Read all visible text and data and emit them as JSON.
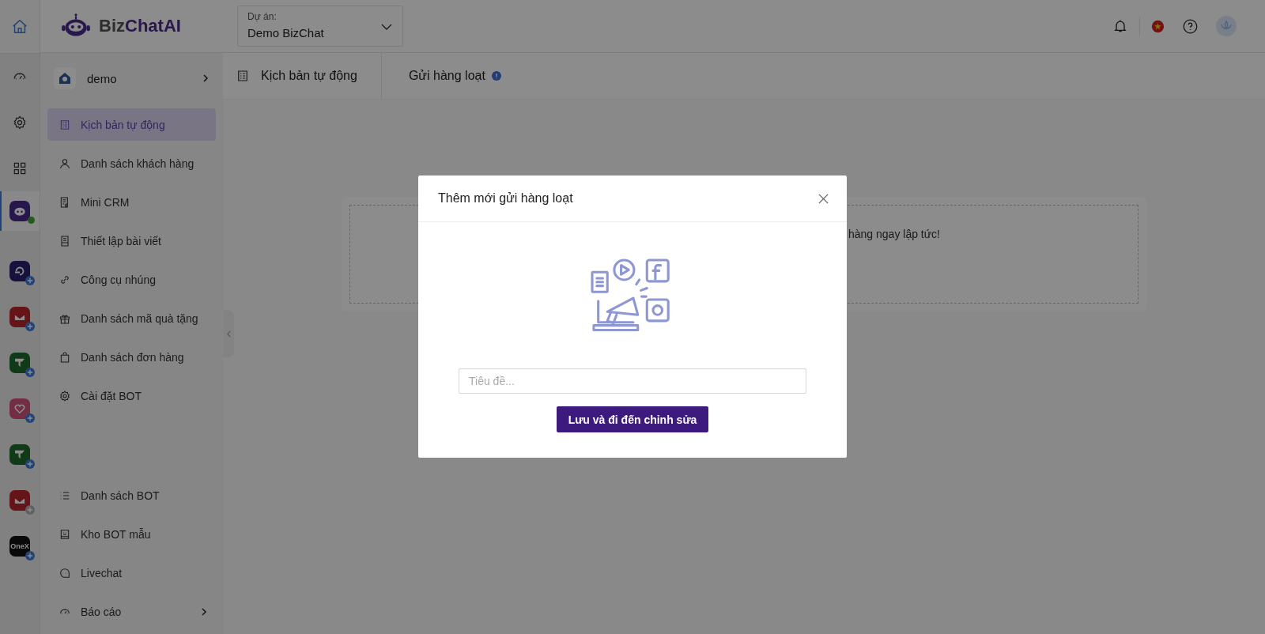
{
  "logo": {
    "part1": "Biz",
    "part2": "ChatAI"
  },
  "project": {
    "label": "Dự án:",
    "value": "Demo BizChat"
  },
  "rail": [
    {
      "kind": "gauge",
      "selected": false
    },
    {
      "kind": "gear",
      "selected": false
    },
    {
      "kind": "grid",
      "selected": false
    }
  ],
  "apps": [
    {
      "kind": "bot",
      "selected": true,
      "online": true
    },
    {
      "kind": "ring",
      "selected": false,
      "online": false,
      "plus_active": true
    },
    {
      "kind": "mail",
      "selected": false,
      "online": false,
      "plus_active": true
    },
    {
      "kind": "tee",
      "selected": false,
      "online": false,
      "plus_active": true
    },
    {
      "kind": "heart",
      "selected": false,
      "online": false,
      "plus_active": true
    },
    {
      "kind": "tee",
      "selected": false,
      "online": false,
      "plus_active": true
    },
    {
      "kind": "mail",
      "selected": false,
      "online": false,
      "plus_active": false
    },
    {
      "kind": "onex",
      "label": "OneX",
      "selected": false,
      "online": false,
      "plus_active": true
    }
  ],
  "bot": {
    "name": "demo"
  },
  "menu": [
    {
      "kind": "doc",
      "label": "Kịch bản tự động",
      "selected": true
    },
    {
      "kind": "user",
      "label": "Danh sách khách hàng",
      "selected": false
    },
    {
      "kind": "crm",
      "label": "Mini CRM",
      "selected": false
    },
    {
      "kind": "post",
      "label": "Thiết lập bài viết",
      "selected": false
    },
    {
      "kind": "link",
      "label": "Công cụ nhúng",
      "selected": false
    },
    {
      "kind": "gift",
      "label": "Danh sách mã quà tặng",
      "selected": false
    },
    {
      "kind": "bag",
      "label": "Danh sách đơn hàng",
      "selected": false
    },
    {
      "kind": "gear",
      "label": "Cài đặt BOT",
      "selected": false
    }
  ],
  "bottom_menu": [
    {
      "kind": "list",
      "label": "Danh sách BOT",
      "selected": false,
      "expandable": false
    },
    {
      "kind": "template",
      "label": "Kho BOT mẫu",
      "selected": false,
      "expandable": false
    },
    {
      "kind": "chat",
      "label": "Livechat",
      "selected": false,
      "expandable": false
    },
    {
      "kind": "gauge",
      "label": "Báo cáo",
      "selected": false,
      "expandable": true
    }
  ],
  "breadcrumb": [
    {
      "label": "Kịch bản tự động",
      "info": false
    },
    {
      "label": "Gửi hàng loạt",
      "info": true
    }
  ],
  "card": {
    "text": "hàng ngay lập tức!"
  },
  "modal": {
    "title": "Thêm mới gửi hàng loạt",
    "placeholder": "Tiêu đề...",
    "button": "Lưu và đi đến chỉnh sửa"
  }
}
